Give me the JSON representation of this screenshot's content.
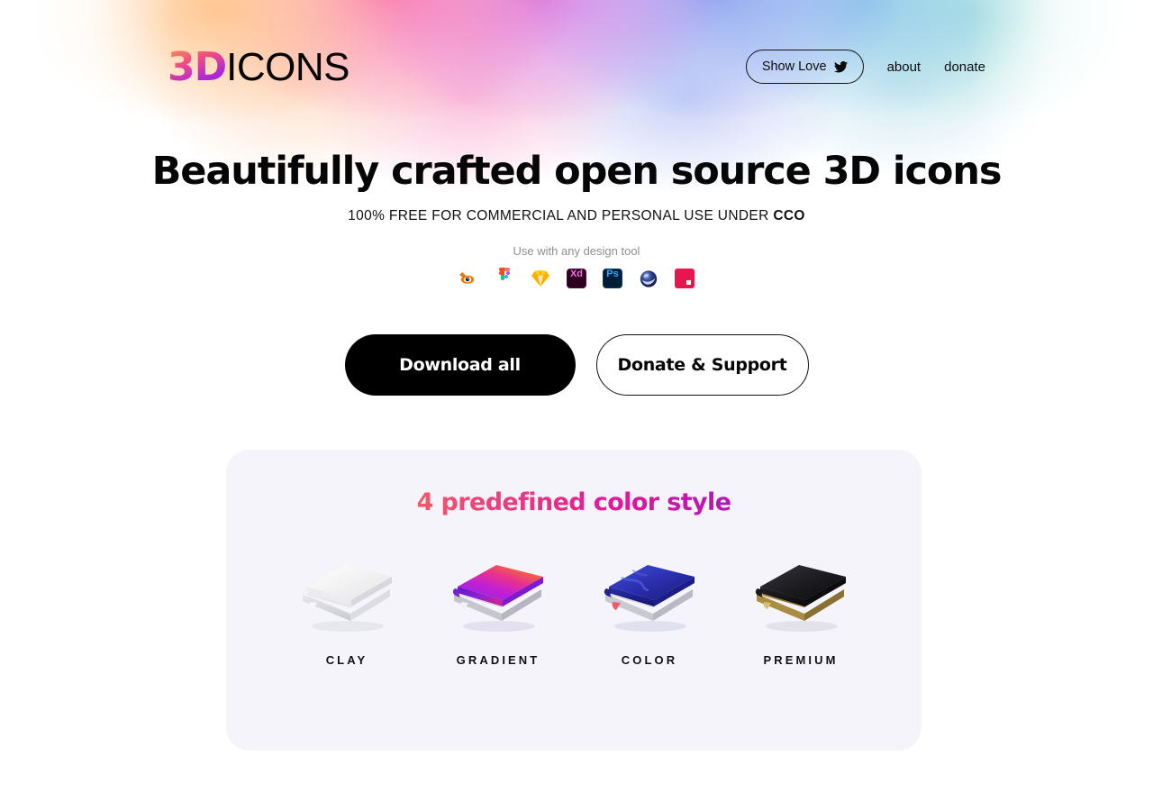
{
  "brand": {
    "logo_prefix": "3D",
    "logo_suffix": "ICONS",
    "gradient_start": "#f9a03c",
    "gradient_end": "#7b27c9"
  },
  "header": {
    "show_love_label": "Show Love",
    "show_love_icon": "twitter-bird-icon",
    "nav_links": [
      {
        "label": "about"
      },
      {
        "label": "donate"
      }
    ]
  },
  "hero": {
    "title": "Beautifully crafted open source 3D icons",
    "subtitle_prefix": "100% FREE FOR COMMERCIAL AND PERSONAL USE UNDER ",
    "subtitle_strong": "CCO",
    "tools_label": "Use with any design tool",
    "tools": [
      {
        "name": "blender-icon",
        "label": "Blender",
        "color": "#ea7600"
      },
      {
        "name": "figma-icon",
        "label": "Figma",
        "color": "#f24e1e"
      },
      {
        "name": "sketch-icon",
        "label": "Sketch",
        "color": "#fdb300"
      },
      {
        "name": "adobe-xd-icon",
        "label": "Xd",
        "color": "#ff61f6"
      },
      {
        "name": "photoshop-icon",
        "label": "Ps",
        "color": "#31a8ff"
      },
      {
        "name": "cinema-4d-icon",
        "label": "Cinema 4D",
        "color": "#1f2a6e"
      },
      {
        "name": "spline-icon",
        "label": "Spline",
        "color": "#e8164f"
      }
    ]
  },
  "cta": {
    "primary_label": "Download all",
    "secondary_label": "Donate & Support"
  },
  "styles_section": {
    "title": "4 predefined color style",
    "items": [
      {
        "label": "CLAY",
        "art": "clay-book-3d-icon"
      },
      {
        "label": "GRADIENT",
        "art": "gradient-book-3d-icon"
      },
      {
        "label": "COLOR",
        "art": "color-book-3d-icon"
      },
      {
        "label": "PREMIUM",
        "art": "premium-book-3d-icon"
      }
    ],
    "card_background": "#f5f4fa"
  }
}
